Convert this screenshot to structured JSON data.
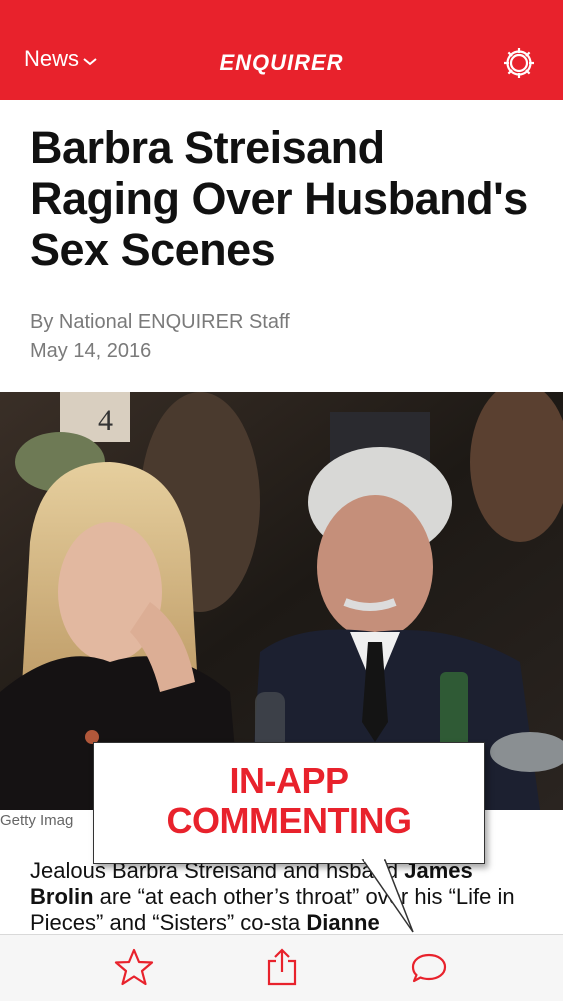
{
  "header": {
    "section_label": "News",
    "brand": "ENQUIRER"
  },
  "icons": {
    "chevron": "chevron-down-icon",
    "settings": "gear-icon",
    "favorite": "star-icon",
    "share": "share-icon",
    "comments": "comment-icon"
  },
  "colors": {
    "brand_red": "#e8222c",
    "byline_gray": "#7a7a7a",
    "tabbar_bg": "#f6f6f6"
  },
  "article": {
    "title": "Barbra Streisand Raging Over Husband's Sex Scenes",
    "author": "By National ENQUIRER Staff",
    "date": "May 14, 2016",
    "photo_credit": "Getty Imag",
    "body": {
      "p1": "Jealous Barbra Streisand and h",
      "p2": "sband ",
      "p3": "James Brolin",
      "p4": " are “at each other’s throat",
      "p5": "” over his “Life in Pieces” and “Sisters” co-sta",
      "p6": "Dianne"
    }
  },
  "callout": {
    "line1": "IN-APP",
    "line2": "COMMENTING"
  }
}
